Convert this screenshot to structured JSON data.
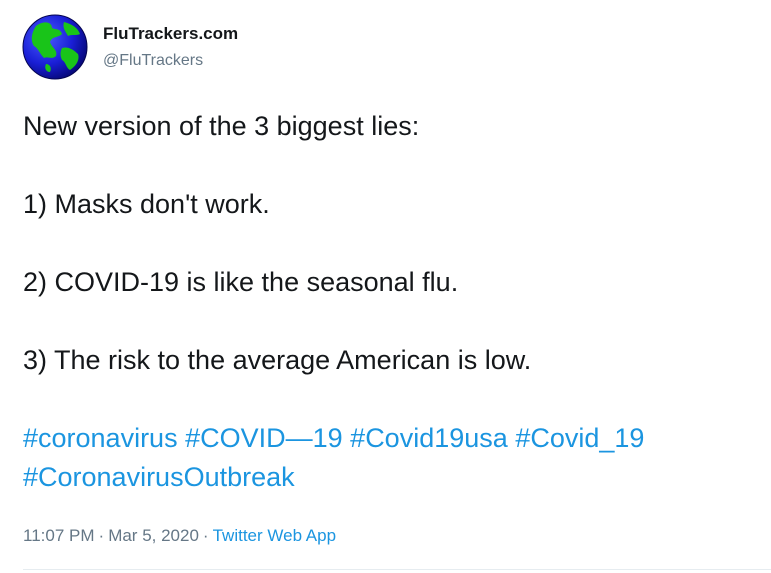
{
  "author": {
    "display_name": "FluTrackers.com",
    "handle": "@FluTrackers",
    "avatar_icon": "globe-icon"
  },
  "tweet": {
    "lines": [
      "New version of the 3 biggest lies:",
      "1) Masks don't work.",
      "2) COVID-19 is like the seasonal flu.",
      "3) The risk to the average American is low."
    ],
    "hashtags": [
      "#coronavirus",
      "#COVID—19",
      "#Covid19usa",
      "#Covid_19",
      "#CoronavirusOutbreak"
    ]
  },
  "meta": {
    "time": "11:07 PM",
    "separator": "·",
    "date": "Mar 5, 2020",
    "source": "Twitter Web App"
  },
  "colors": {
    "link": "#1b95e0",
    "text": "#14171a",
    "secondary": "#657786",
    "divider": "#e6ecf0"
  }
}
